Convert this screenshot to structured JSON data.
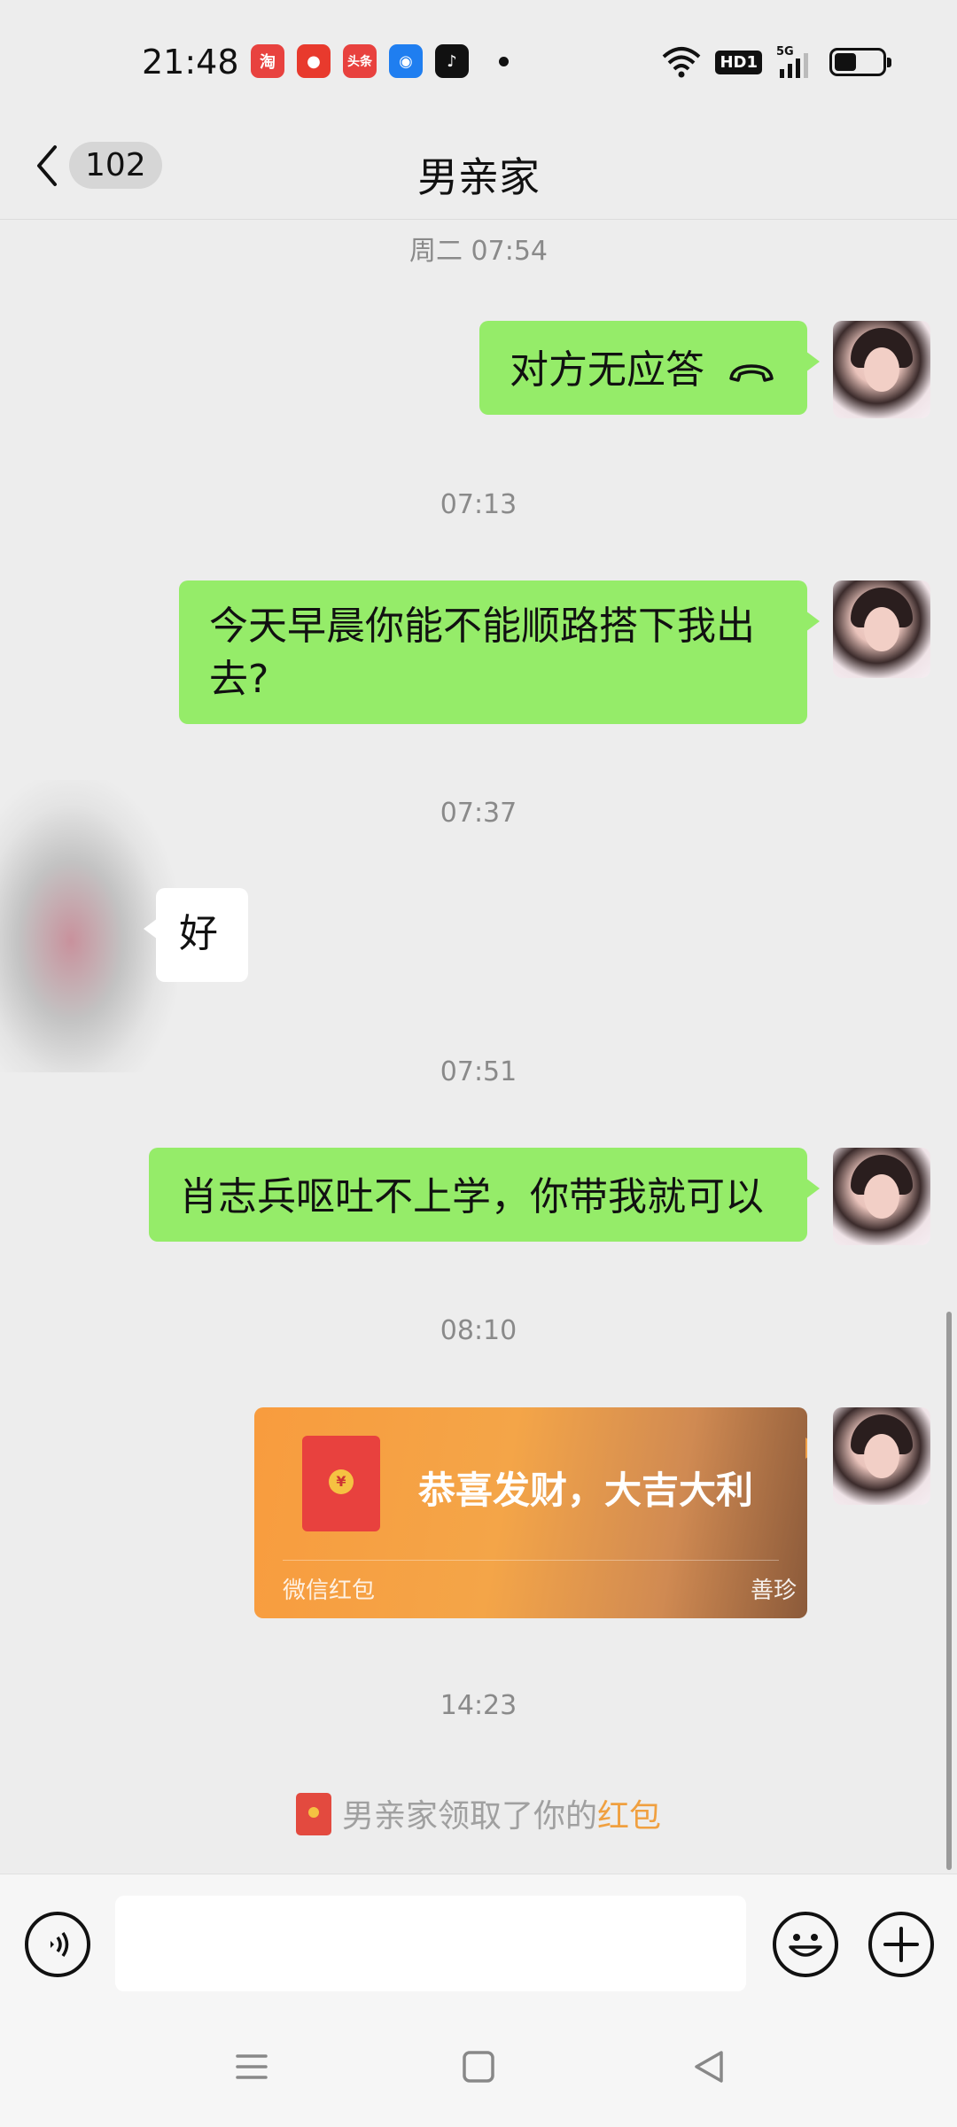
{
  "status_bar": {
    "time": "21:48",
    "apps": [
      {
        "icon": "taobao-icon",
        "text": "淘",
        "color": "#e8423f"
      },
      {
        "icon": "app-icon",
        "text": "",
        "color": "#e83a2d"
      },
      {
        "icon": "toutiao-icon",
        "text": "头条",
        "color": "#e8413e"
      },
      {
        "icon": "app-icon",
        "text": "",
        "color": "#1f7ef0"
      },
      {
        "icon": "tiktok-icon",
        "text": "",
        "color": "#111111"
      }
    ],
    "hd_label": "HD1",
    "network": "5G"
  },
  "nav": {
    "back_count": "102",
    "title": "男亲家"
  },
  "messages": [
    {
      "type": "timestamp",
      "text": "周二 07:54"
    },
    {
      "type": "outgoing",
      "text": "对方无应答",
      "icon": "phone-hangup-icon"
    },
    {
      "type": "timestamp",
      "text": "07:13"
    },
    {
      "type": "outgoing",
      "text": "今天早晨你能不能顺路搭下我出去?"
    },
    {
      "type": "timestamp",
      "text": "07:37"
    },
    {
      "type": "incoming",
      "text": "好"
    },
    {
      "type": "timestamp",
      "text": "07:51"
    },
    {
      "type": "outgoing",
      "text": "肖志兵呕吐不上学，你带我就可以"
    },
    {
      "type": "timestamp",
      "text": "08:10"
    },
    {
      "type": "red_packet",
      "title": "恭喜发财，大吉大利",
      "source": "微信红包",
      "sender": "善珍"
    },
    {
      "type": "timestamp",
      "text": "14:23"
    }
  ],
  "system_message": {
    "prefix": "男亲家领取了你的",
    "highlight": "红包"
  },
  "input_bar": {
    "placeholder": ""
  },
  "colors": {
    "bubble_green": "#95ec69",
    "red_packet_orange": "#f89c3e",
    "highlight": "#f0a040"
  }
}
